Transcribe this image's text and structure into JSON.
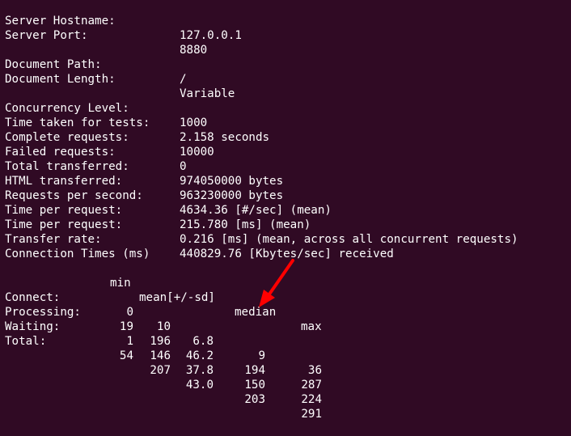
{
  "server": {
    "hostname_label": "Server Hostname:",
    "hostname": "127.0.0.1",
    "port_label": "Server Port:",
    "port": "8880"
  },
  "document": {
    "path_label": "Document Path:",
    "path": "/",
    "length_label": "Document Length:",
    "length": "Variable"
  },
  "stats": [
    {
      "label": "Concurrency Level:",
      "value": "1000"
    },
    {
      "label": "Time taken for tests:",
      "value": "2.158 seconds"
    },
    {
      "label": "Complete requests:",
      "value": "10000"
    },
    {
      "label": "Failed requests:",
      "value": "0"
    },
    {
      "label": "Total transferred:",
      "value": "974050000 bytes"
    },
    {
      "label": "HTML transferred:",
      "value": "963230000 bytes"
    },
    {
      "label": "Requests per second:",
      "value": "4634.36 [#/sec] (mean)"
    },
    {
      "label": "Time per request:",
      "value": "215.780 [ms] (mean)"
    },
    {
      "label": "Time per request:",
      "value": "0.216 [ms] (mean, across all concurrent requests)"
    },
    {
      "label": "Transfer rate:",
      "value": "440829.76 [Kbytes/sec] received"
    }
  ],
  "connection_times": {
    "title": "Connection Times (ms)",
    "headers": {
      "min": "min",
      "mean_sd": "mean[+/-sd]",
      "median": "median",
      "max": "max"
    },
    "rows": [
      {
        "label": "Connect:",
        "min": "0",
        "mean": "10",
        "sd": "6.8",
        "median": "9",
        "max": "36"
      },
      {
        "label": "Processing:",
        "min": "19",
        "mean": "196",
        "sd": "46.2",
        "median": "194",
        "max": "287"
      },
      {
        "label": "Waiting:",
        "min": "1",
        "mean": "146",
        "sd": "37.8",
        "median": "150",
        "max": "224"
      },
      {
        "label": "Total:",
        "min": "54",
        "mean": "207",
        "sd": "43.0",
        "median": "203",
        "max": "291"
      }
    ]
  },
  "colors": {
    "background": "#300a24",
    "text": "#ffffff",
    "annotation_arrow": "#ff0000"
  },
  "icons": {
    "annotation": "red-arrow-icon"
  }
}
